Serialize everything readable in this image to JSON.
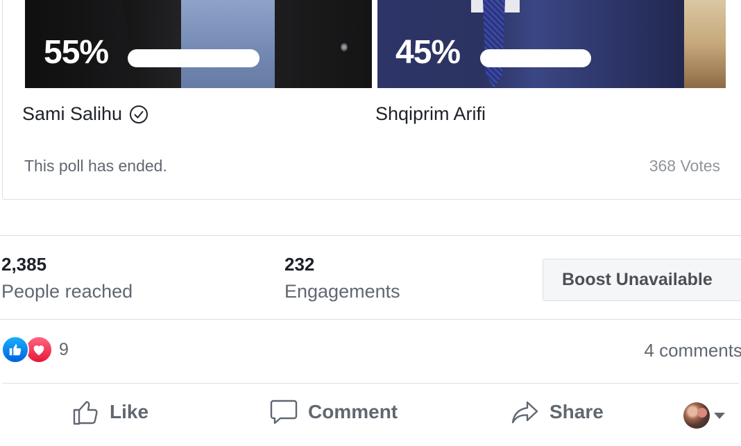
{
  "poll": {
    "options": [
      {
        "name": "Sami Salihu",
        "percent_label": "55%",
        "percent": 55,
        "verified": true
      },
      {
        "name": "Shqiprim Arifi",
        "percent_label": "45%",
        "percent": 45,
        "verified": false
      }
    ],
    "status": "This poll has ended.",
    "votes": "368 Votes"
  },
  "insights": {
    "reach_value": "2,385",
    "reach_label": "People reached",
    "engagements_value": "232",
    "engagements_label": "Engagements",
    "boost_label": "Boost Unavailable"
  },
  "reactions": {
    "icons": [
      "like-reaction-icon",
      "love-reaction-icon"
    ],
    "count": "9",
    "comments": "4 comments"
  },
  "actions": {
    "like": "Like",
    "comment": "Comment",
    "share": "Share"
  },
  "colors": {
    "like_blue": "#1877f2",
    "love_red": "#f33e58",
    "text_secondary": "#606770"
  }
}
